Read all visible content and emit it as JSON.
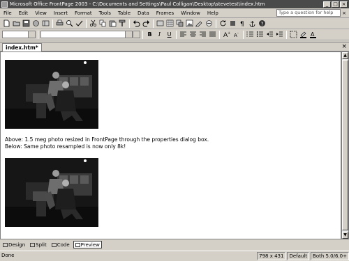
{
  "window": {
    "title": "Microsoft Office FrontPage 2003 - C:\\Documents and Settings\\Paul Colligan\\Desktop\\stevetest\\index.htm",
    "min": "_",
    "max": "□",
    "close": "×"
  },
  "menu": {
    "items": [
      "File",
      "Edit",
      "View",
      "Insert",
      "Format",
      "Tools",
      "Table",
      "Data",
      "Frames",
      "Window",
      "Help"
    ],
    "help_placeholder": "Type a question for help",
    "help_close": "×"
  },
  "toolbar_icons": [
    "new-page-icon",
    "open-icon",
    "save-icon",
    "publish-icon",
    "folder-list-icon",
    "print-icon",
    "preview-icon",
    "spelling-icon",
    "cut-icon",
    "copy-icon",
    "paste-icon",
    "format-painter-icon",
    "undo-icon",
    "redo-icon",
    "web-component-icon",
    "insert-table-icon",
    "layer-icon",
    "insert-picture-icon",
    "drawing-icon",
    "hyperlink-icon",
    "refresh-icon",
    "stop-icon",
    "show-all-icon",
    "help-icon"
  ],
  "format_toolbar": {
    "bold": "B",
    "italic": "I",
    "underline": "U"
  },
  "document_tab": {
    "label": "index.htm*",
    "close": "×"
  },
  "editor": {
    "line1": "Above: 1.5 meg photo resized in FrontPage through the properties dialog box.",
    "line2": "Below: Same photo resampled is now only 8k!"
  },
  "view_tabs": [
    {
      "label": "Design",
      "active": false
    },
    {
      "label": "Split",
      "active": false
    },
    {
      "label": "Code",
      "active": false
    },
    {
      "label": "Preview",
      "active": true
    }
  ],
  "status": {
    "message": "Done",
    "page_size": "798 x 431",
    "css": "Default",
    "compat": "Both 5.0/6.0+"
  }
}
